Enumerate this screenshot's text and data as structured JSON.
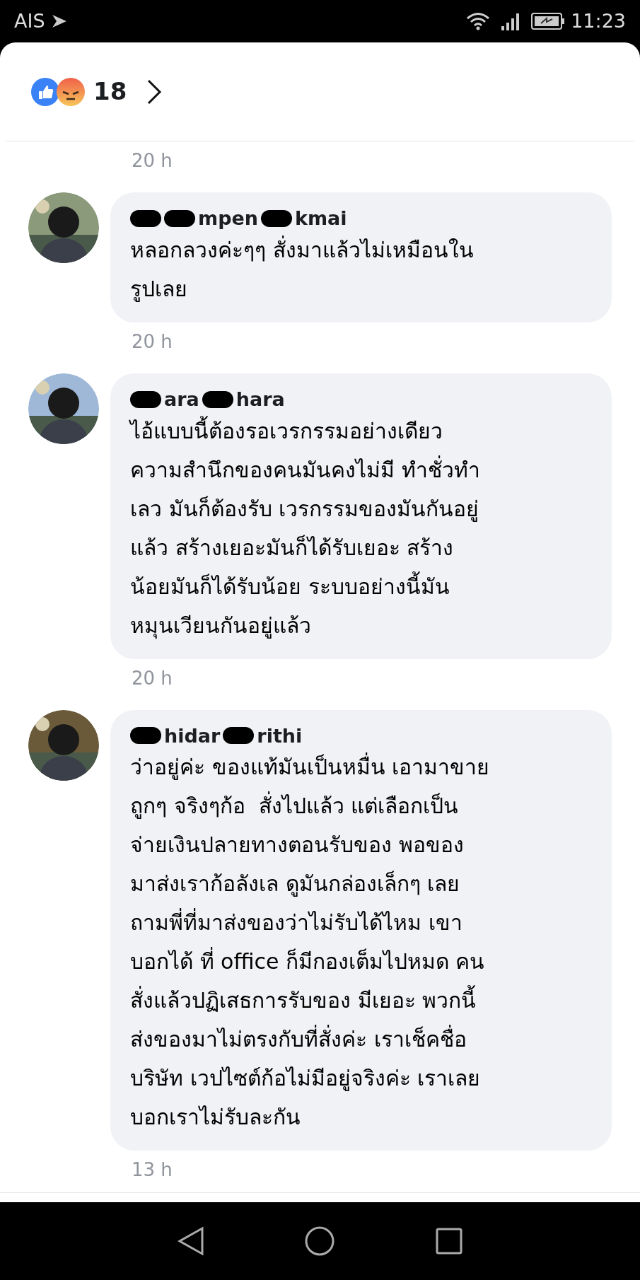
{
  "status_bar": {
    "carrier": "AIS",
    "time": "11:23"
  },
  "reactions": {
    "count": "18"
  },
  "top_timestamp": "20 h",
  "comments": [
    {
      "name_parts": [
        {
          "kind": "redaction"
        },
        {
          "kind": "redaction"
        },
        {
          "kind": "text",
          "text": "mpen"
        },
        {
          "kind": "redaction"
        },
        {
          "kind": "text",
          "text": "kmai"
        }
      ],
      "lines": [
        "หลอกลวงค่ะๆๆ สั่งมาแล้วไม่เหมือนใน",
        "รูปเลย"
      ],
      "time": "20 h"
    },
    {
      "name_parts": [
        {
          "kind": "redaction"
        },
        {
          "kind": "text",
          "text": "ara"
        },
        {
          "kind": "redaction"
        },
        {
          "kind": "text",
          "text": "hara"
        }
      ],
      "lines": [
        "ไอ้แบบนี้ต้องรอเวรกรรมอย่างเดียว",
        "ความสำนึกของคนมันคงไม่มี ทำชั่วทำ",
        "เลว มันก็ต้องรับ เวรกรรมของมันกันอยู่",
        "แล้ว สร้างเยอะมันก็ได้รับเยอะ สร้าง",
        "น้อยมันก็ได้รับน้อย ระบบอย่างนี้มัน",
        "หมุนเวียนกันอยู่แล้ว"
      ],
      "time": "20 h"
    },
    {
      "name_parts": [
        {
          "kind": "redaction"
        },
        {
          "kind": "text",
          "text": "hidar"
        },
        {
          "kind": "redaction"
        },
        {
          "kind": "text",
          "text": "rithi"
        }
      ],
      "lines": [
        "ว่าอยู่ค่ะ ของแท้มันเป็นหมื่น เอามาขาย",
        "ถูกๆ จริงๆก้อ  สั่งไปแล้ว แต่เลือกเป็น",
        "จ่ายเงินปลายทางตอนรับของ พอของ",
        "มาส่งเราก้อลังเล ดูมันกล่องเล็กๆ เลย",
        "ถามพี่ที่มาส่งของว่าไม่รับได้ไหม เขา",
        "บอกได้ ที่ office ก็มีกองเต็มไปหมด คน",
        "สั่งแล้วปฏิเสธการรับของ มีเยอะ พวกนี้",
        "ส่งของมาไม่ตรงกับที่สั่งค่ะ เราเช็คชื่อ",
        "บริษัท เวปไซต์ก้อไม่มีอยู่จริงค่ะ เราเลย",
        "บอกเราไม่รับละกัน"
      ],
      "time": "13 h"
    }
  ]
}
